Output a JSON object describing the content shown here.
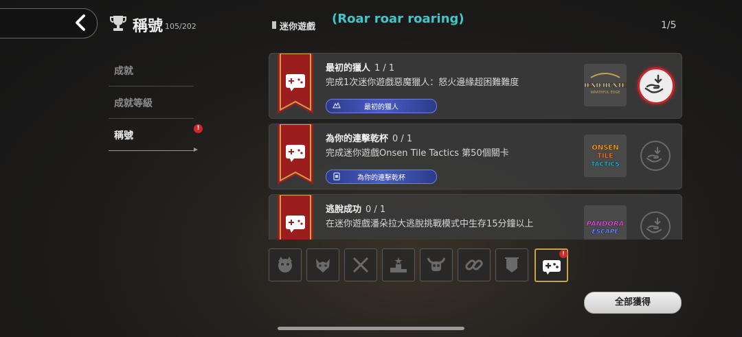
{
  "header": {
    "title": "稱號",
    "title_count": "105/202",
    "category_label": "迷你遊戲",
    "annotation": "(Roar roar roaring)",
    "page_indicator": "1/5"
  },
  "nav": {
    "items": [
      {
        "label": "成就"
      },
      {
        "label": "成就等級"
      },
      {
        "label": "稱號"
      }
    ],
    "badge": "!"
  },
  "achievements": [
    {
      "title": "最初的獵人",
      "progress": "1 / 1",
      "description": "完成1次迷你遊戲惡魔獵人：怒火邊緣超困難難度",
      "tag": "最初的獵人",
      "logo_lines": [
        "FIEND HUNTER",
        "WRATHFUL EDGE"
      ],
      "claimable": true
    },
    {
      "title": "為你的連擊乾杯",
      "progress": "0 / 1",
      "description": "完成迷你遊戲Onsen Tile Tactics 第50個關卡",
      "tag": "為你的連擊乾杯",
      "logo_lines": [
        "ONSEN",
        "TILE",
        "TACTICS"
      ],
      "claimable": false
    },
    {
      "title": "逃脫成功",
      "progress": "0 / 1",
      "description": "在迷你遊戲潘朵拉大逃脫挑戰模式中生存15分鐘以上",
      "tag": "",
      "logo_lines": [
        "PANDORA",
        "ESCAPE"
      ],
      "claimable": false
    }
  ],
  "category_tabs": [
    {
      "icon": "beast-head-icon"
    },
    {
      "icon": "demon-head-icon"
    },
    {
      "icon": "crossed-swords-icon"
    },
    {
      "icon": "podium-icon"
    },
    {
      "icon": "horned-skull-icon"
    },
    {
      "icon": "chain-link-icon"
    },
    {
      "icon": "banner-icon"
    },
    {
      "icon": "gamepad-icon"
    }
  ],
  "tab_badge": "!",
  "claim_all_label": "全部獲得",
  "colors": {
    "accent_gold": "#c9a24a",
    "banner_red": "#9b1d1d",
    "badge_red": "#d02828",
    "tag_blue": "#4a5cc8",
    "annotation_cyan": "#3ec6c9"
  }
}
